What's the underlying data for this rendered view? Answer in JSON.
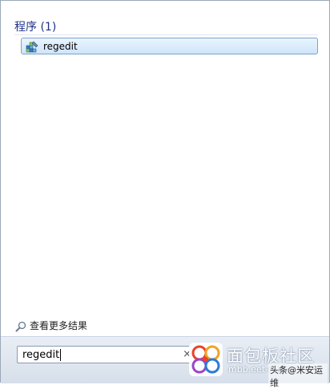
{
  "results": {
    "heading": "程序 (1)",
    "items": [
      {
        "label": "regedit",
        "icon": "registry-editor-icon"
      }
    ]
  },
  "see_more": {
    "label": "查看更多结果",
    "icon": "magnifier-icon"
  },
  "search": {
    "value": "regedit",
    "clear_icon": "×"
  },
  "watermark": {
    "title": "面包板社区",
    "url": "mbb.eet-china.com",
    "badge": "头条@米安运维"
  },
  "colors": {
    "heading": "#1e3287",
    "selection_border": "#7da2ce",
    "selection_fill": "#cfe5fa",
    "search_bar": "#d6dfea"
  }
}
